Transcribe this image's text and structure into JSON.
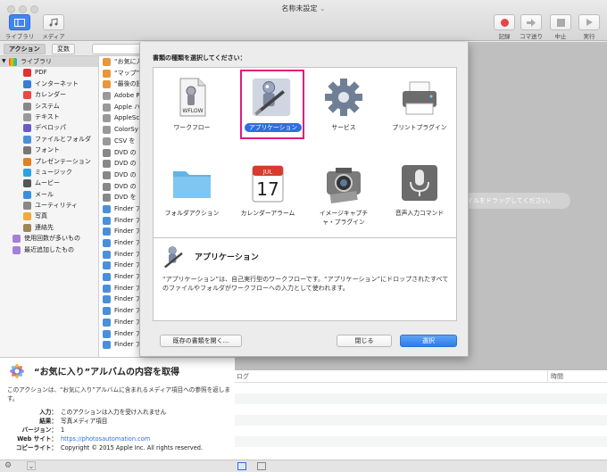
{
  "window": {
    "title": "名称未設定"
  },
  "toolbar": {
    "library_label": "ライブラリ",
    "media_label": "メディア",
    "record_label": "記録",
    "step_label": "コマ送り",
    "stop_label": "中止",
    "run_label": "実行"
  },
  "left_tabs": {
    "actions": "アクション",
    "variables": "変数"
  },
  "library": {
    "root": "ライブラリ",
    "items": [
      "PDF",
      "インターネット",
      "カレンダー",
      "システム",
      "テキスト",
      "デベロッパ",
      "ファイルとフォルダ",
      "フォント",
      "プレゼンテーション",
      "ミュージック",
      "ムービー",
      "メール",
      "ユーティリティ",
      "写真",
      "連絡先"
    ],
    "smart": [
      "使用回数が多いもの",
      "最近追加したもの"
    ]
  },
  "actions_list": [
    "“お気に入",
    "“マップ”",
    "“最後の読",
    "Adobe P",
    "Apple ハ",
    "AppleSc",
    "ColorSy",
    "CSV を",
    "DVD の",
    "DVD の",
    "DVD の",
    "DVD の",
    "DVD を",
    "Finder ア",
    "Finder ア",
    "Finder ア",
    "Finder ア",
    "Finder ア",
    "Finder ア",
    "Finder ア",
    "Finder ア",
    "Finder ア",
    "Finder ア",
    "Finder ア",
    "Finder ア",
    "Finder ア"
  ],
  "description": {
    "title": "“お気に入り”アルバムの内容を取得",
    "body": "このアクションは、“お気に入り”アルバムに含まれるメディア項目への参照を返します。",
    "rows": [
      {
        "k": "入力：",
        "v": "このアクションは入力を受け入れません"
      },
      {
        "k": "結果：",
        "v": "写真メディア項目"
      },
      {
        "k": "バージョン：",
        "v": "1"
      },
      {
        "k": "Web サイト：",
        "v": "https://photosautomation.com"
      },
      {
        "k": "コピーライト：",
        "v": "Copyright © 2015 Apple Inc. All rights reserved."
      }
    ]
  },
  "workflow": {
    "drop_hint": "イルをドラッグしてください。"
  },
  "log": {
    "col_log": "ログ",
    "col_time": "時間"
  },
  "sheet": {
    "prompt": "書類の種類を選択してください：",
    "types": [
      {
        "label": "ワークフロー",
        "icon": "workflow-icon"
      },
      {
        "label": "アプリケーション",
        "icon": "application-icon"
      },
      {
        "label": "サービス",
        "icon": "gear-icon"
      },
      {
        "label": "プリントプラグイン",
        "icon": "printer-icon"
      },
      {
        "label": "フォルダアクション",
        "icon": "folder-icon"
      },
      {
        "label": "カレンダーアラーム",
        "icon": "calendar-icon"
      },
      {
        "label": "イメージキャプチャ・プラグイン",
        "label_line1": "イメージキャプチ",
        "label_line2": "ャ・プラグイン",
        "icon": "camera-icon"
      },
      {
        "label": "音声入力コマンド",
        "icon": "microphone-icon"
      }
    ],
    "workflow_file_text": "WFLOW",
    "calendar_month": "JUL",
    "calendar_day": "17",
    "selected_title": "アプリケーション",
    "selected_desc": "“アプリケーション”は、自己実行型のワークフローです。“アプリケーション”にドロップされたすべてのファイルやフォルダがワークフローへの入力として使われます。",
    "open_button": "既存の書類を開く...",
    "close_button": "閉じる",
    "choose_button": "選択"
  },
  "colors": {
    "selection_border": "#e2187f",
    "accent": "#2f6fdb"
  }
}
